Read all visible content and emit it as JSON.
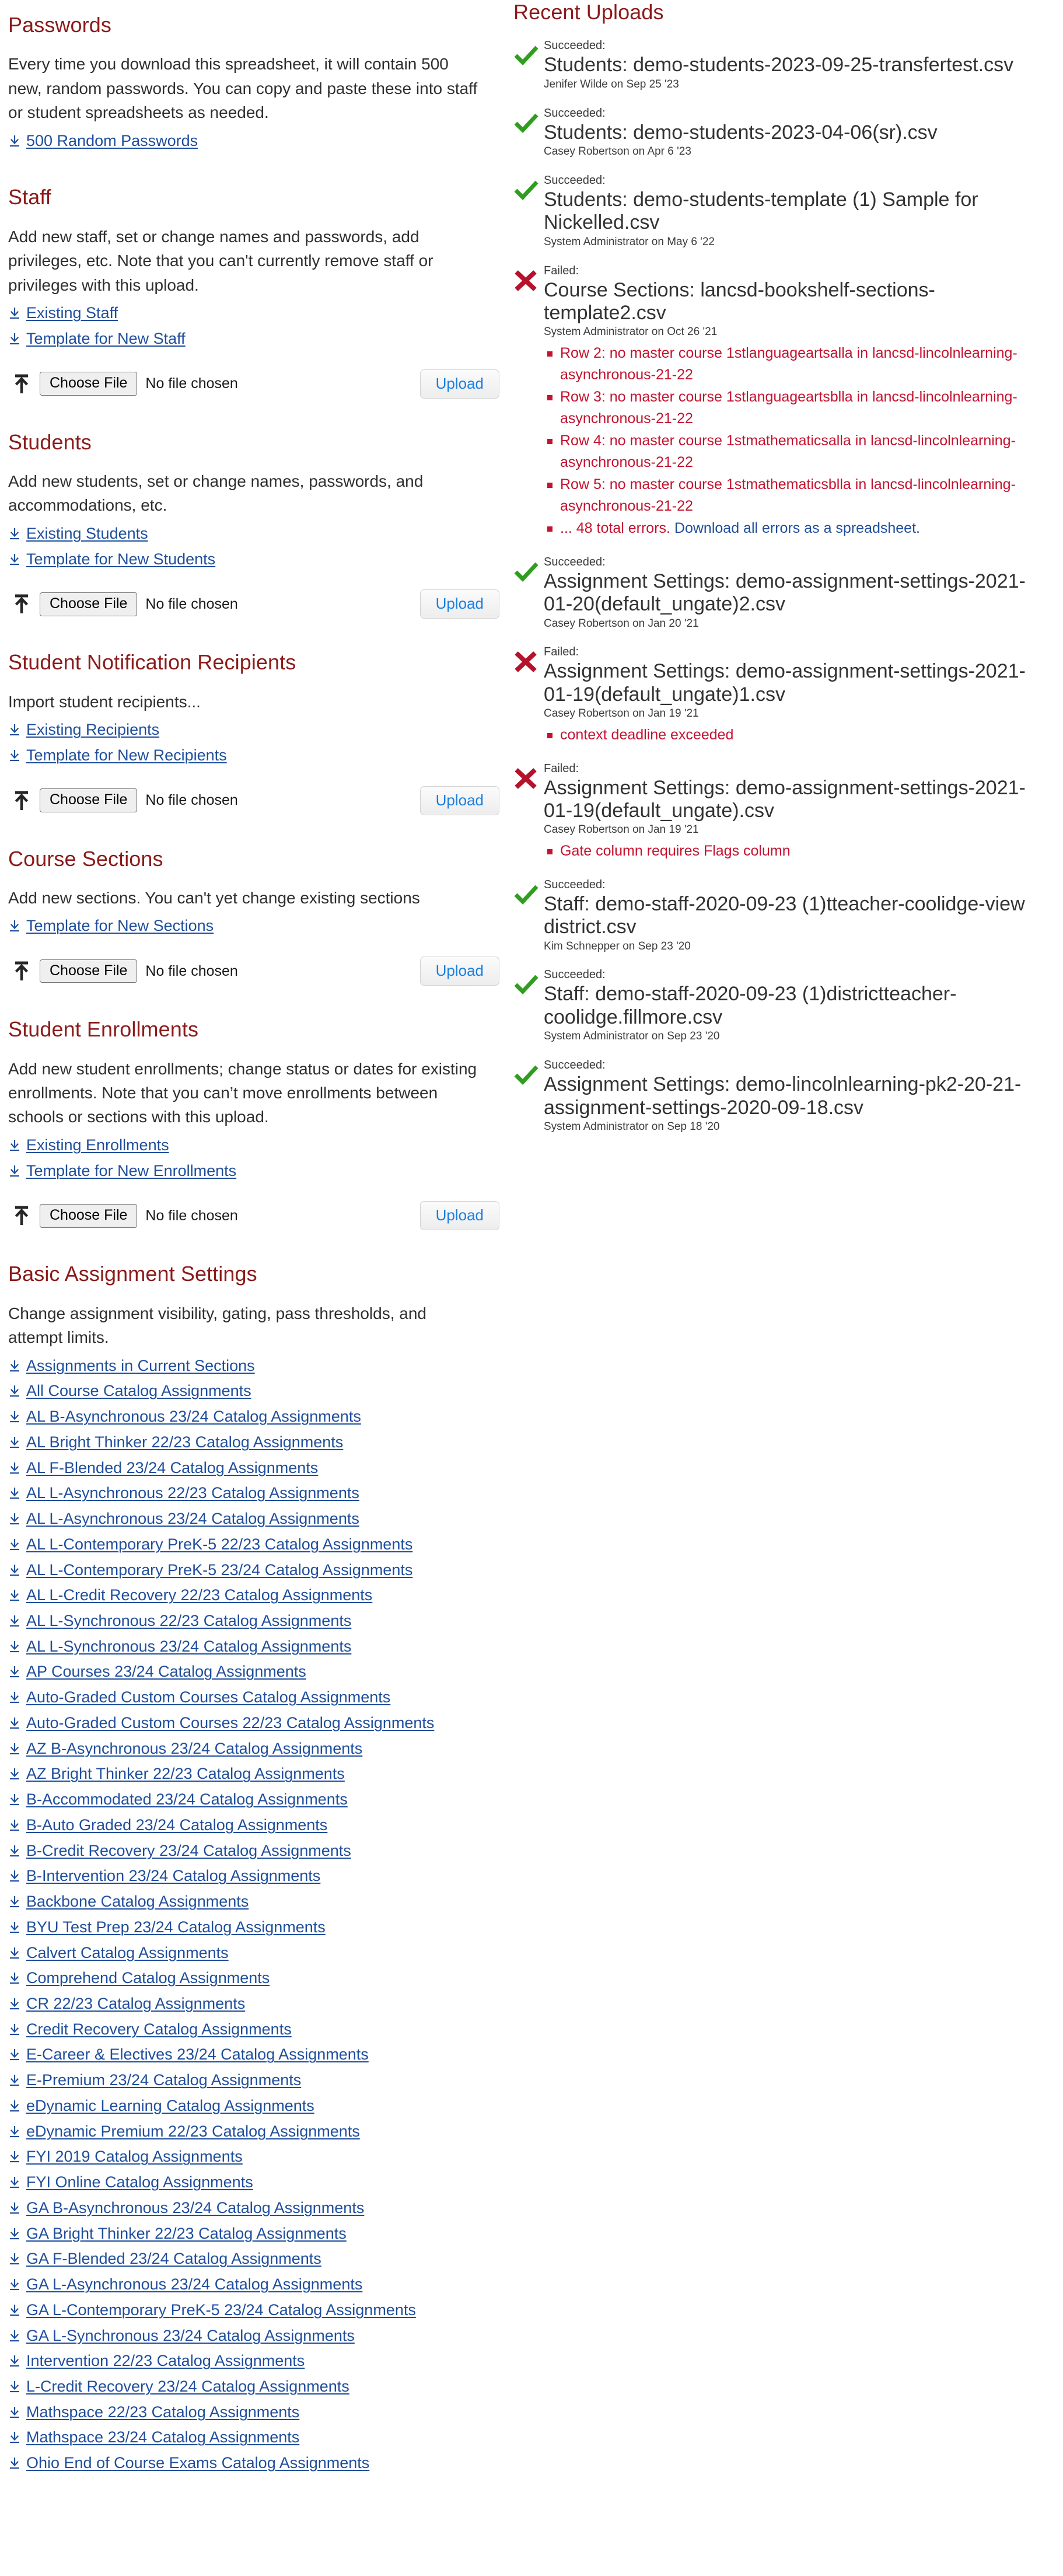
{
  "colors": {
    "heading": "#8c1b1b",
    "link": "#1f4e9c",
    "error": "#c4122f",
    "success": "#2f9e1f",
    "upload_label": "#1a7fe0"
  },
  "common": {
    "choose_file_label": "Choose File",
    "no_file_label": "No file chosen",
    "upload_label": "Upload"
  },
  "sections": [
    {
      "title": "Passwords",
      "desc": "Every time you download this spreadsheet, it will contain 500 new, random passwords. You can copy and paste these into staff or student spreadsheets as needed.",
      "links": [
        "500 Random Passwords"
      ],
      "has_upload": false
    },
    {
      "title": "Staff",
      "desc": "Add new staff, set or change names and passwords, add privileges, etc. Note that you can't currently remove staff or privileges with this upload.",
      "links": [
        "Existing Staff",
        "Template for New Staff"
      ],
      "has_upload": true
    },
    {
      "title": "Students",
      "desc": "Add new students, set or change names, passwords, and accommodations, etc.",
      "links": [
        "Existing Students",
        "Template for New Students"
      ],
      "has_upload": true
    },
    {
      "title": "Student Notification Recipients",
      "desc": "Import student recipients...",
      "links": [
        "Existing Recipients",
        "Template for New Recipients"
      ],
      "has_upload": true
    },
    {
      "title": "Course Sections",
      "desc": "Add new sections. You can't yet change existing sections",
      "links": [
        "Template for New Sections"
      ],
      "has_upload": true
    },
    {
      "title": "Student Enrollments",
      "desc": "Add new student enrollments; change status or dates for existing enrollments. Note that you can’t move enrollments between schools or sections with this upload.",
      "links": [
        "Existing Enrollments",
        "Template for New Enrollments"
      ],
      "has_upload": true
    },
    {
      "title": "Basic Assignment Settings",
      "desc": "Change assignment visibility, gating, pass thresholds, and attempt limits.",
      "links": [
        "Assignments in Current Sections",
        "All Course Catalog Assignments",
        "AL B-Asynchronous 23/24 Catalog Assignments",
        "AL Bright Thinker 22/23 Catalog Assignments",
        "AL F-Blended 23/24 Catalog Assignments",
        "AL L-Asynchronous 22/23 Catalog Assignments",
        "AL L-Asynchronous 23/24 Catalog Assignments",
        "AL L-Contemporary PreK-5 22/23 Catalog Assignments",
        "AL L-Contemporary PreK-5 23/24 Catalog Assignments",
        "AL L-Credit Recovery 22/23 Catalog Assignments",
        "AL L-Synchronous 22/23 Catalog Assignments",
        "AL L-Synchronous 23/24 Catalog Assignments",
        "AP Courses 23/24 Catalog Assignments",
        "Auto-Graded Custom Courses Catalog Assignments",
        "Auto-Graded Custom Courses 22/23 Catalog Assignments",
        "AZ B-Asynchronous 23/24 Catalog Assignments",
        "AZ Bright Thinker 22/23 Catalog Assignments",
        "B-Accommodated 23/24 Catalog Assignments",
        "B-Auto Graded 23/24 Catalog Assignments",
        "B-Credit Recovery 23/24 Catalog Assignments",
        "B-Intervention 23/24 Catalog Assignments",
        "Backbone Catalog Assignments",
        "BYU Test Prep 23/24 Catalog Assignments",
        "Calvert Catalog Assignments",
        "Comprehend Catalog Assignments",
        "CR 22/23 Catalog Assignments",
        "Credit Recovery Catalog Assignments",
        "E-Career & Electives 23/24 Catalog Assignments",
        "E-Premium 23/24 Catalog Assignments",
        "eDynamic Learning Catalog Assignments",
        "eDynamic Premium 22/23 Catalog Assignments",
        "FYI 2019 Catalog Assignments",
        "FYI Online Catalog Assignments",
        "GA B-Asynchronous 23/24 Catalog Assignments",
        "GA Bright Thinker 22/23 Catalog Assignments",
        "GA F-Blended 23/24 Catalog Assignments",
        "GA L-Asynchronous 23/24 Catalog Assignments",
        "GA L-Contemporary PreK-5 23/24 Catalog Assignments",
        "GA L-Synchronous 23/24 Catalog Assignments",
        "Intervention 22/23 Catalog Assignments",
        "L-Credit Recovery 23/24 Catalog Assignments",
        "Mathspace 22/23 Catalog Assignments",
        "Mathspace 23/24 Catalog Assignments",
        "Ohio End of Course Exams Catalog Assignments"
      ],
      "has_upload": false
    }
  ],
  "recent_uploads": {
    "title": "Recent Uploads",
    "items": [
      {
        "status": "Succeeded:",
        "state": "success",
        "name": "Students: demo-students-2023-09-25-transfertest.csv",
        "user": "Jenifer Wilde",
        "date": "on Sep 25 '23",
        "errors": []
      },
      {
        "status": "Succeeded:",
        "state": "success",
        "name": "Students: demo-students-2023-04-06(sr).csv",
        "user": "Casey Robertson",
        "date": "on Apr 6 '23",
        "errors": []
      },
      {
        "status": "Succeeded:",
        "state": "success",
        "name": "Students: demo-students-template (1) Sample for Nickelled.csv",
        "user": "System Administrator",
        "date": "on May 6 '22",
        "errors": []
      },
      {
        "status": "Failed:",
        "state": "failed",
        "name": "Course Sections: lancsd-bookshelf-sections-template2.csv",
        "user": "System Administrator",
        "date": "on Oct 26 '21",
        "errors": [
          {
            "text": "Row 2: no master course 1stlanguageartsalla in lancsd-lincolnlearning-asynchronous-21-22"
          },
          {
            "text": "Row 3: no master course 1stlanguageartsblla in lancsd-lincolnlearning-asynchronous-21-22"
          },
          {
            "text": "Row 4: no master course 1stmathematicsalla in lancsd-lincolnlearning-asynchronous-21-22"
          },
          {
            "text": "Row 5: no master course 1stmathematicsblla in lancsd-lincolnlearning-asynchronous-21-22"
          },
          {
            "text": "... 48 total errors.",
            "link": "Download all errors as a spreadsheet."
          }
        ]
      },
      {
        "status": "Succeeded:",
        "state": "success",
        "name": "Assignment Settings: demo-assignment-settings-2021-01-20(default_ungate)2.csv",
        "user": "Casey Robertson",
        "date": "on Jan 20 '21",
        "errors": []
      },
      {
        "status": "Failed:",
        "state": "failed",
        "name": "Assignment Settings: demo-assignment-settings-2021-01-19(default_ungate)1.csv",
        "user": "Casey Robertson",
        "date": "on Jan 19 '21",
        "errors": [
          {
            "text": "context deadline exceeded"
          }
        ]
      },
      {
        "status": "Failed:",
        "state": "failed",
        "name": "Assignment Settings: demo-assignment-settings-2021-01-19(default_ungate).csv",
        "user": "Casey Robertson",
        "date": "on Jan 19 '21",
        "errors": [
          {
            "text": "Gate column requires Flags column"
          }
        ]
      },
      {
        "status": "Succeeded:",
        "state": "success",
        "name": "Staff: demo-staff-2020-09-23 (1)tteacher-coolidge-view district.csv",
        "user": "Kim Schnepper",
        "date": "on Sep 23 '20",
        "errors": []
      },
      {
        "status": "Succeeded:",
        "state": "success",
        "name": "Staff: demo-staff-2020-09-23 (1)districtteacher-coolidge.fillmore.csv",
        "user": "System Administrator",
        "date": "on Sep 23 '20",
        "errors": []
      },
      {
        "status": "Succeeded:",
        "state": "success",
        "name": "Assignment Settings: demo-lincolnlearning-pk2-20-21-assignment-settings-2020-09-18.csv",
        "user": "System Administrator",
        "date": "on Sep 18 '20",
        "errors": []
      }
    ]
  }
}
